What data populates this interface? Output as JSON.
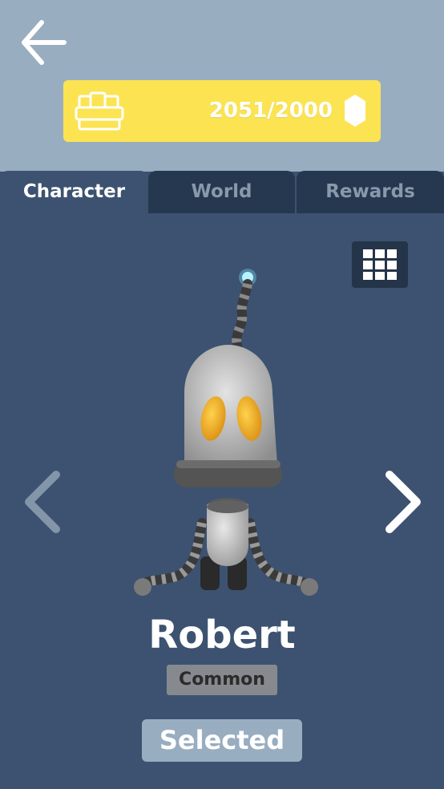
{
  "header": {
    "back_icon": "arrow-left-icon",
    "progress": {
      "icon": "treasure-chest-icon",
      "text": "2051/2000",
      "current": 2051,
      "goal": 2000,
      "currency_icon": "gem-icon",
      "banner_color": "#fce352"
    }
  },
  "tabs": [
    {
      "label": "Character",
      "active": true
    },
    {
      "label": "World",
      "active": false
    },
    {
      "label": "Rewards",
      "active": false
    }
  ],
  "viewer": {
    "grid_icon": "grid-icon",
    "prev_icon": "chevron-left-icon",
    "next_icon": "chevron-right-icon",
    "character_icon": "robot-character"
  },
  "character": {
    "name": "Robert",
    "rarity": "Common",
    "status_label": "Selected"
  },
  "colors": {
    "top_background": "#99adc1",
    "panel_background": "#3c5270",
    "inactive_tab": "#263850",
    "accent_yellow": "#fce352"
  }
}
